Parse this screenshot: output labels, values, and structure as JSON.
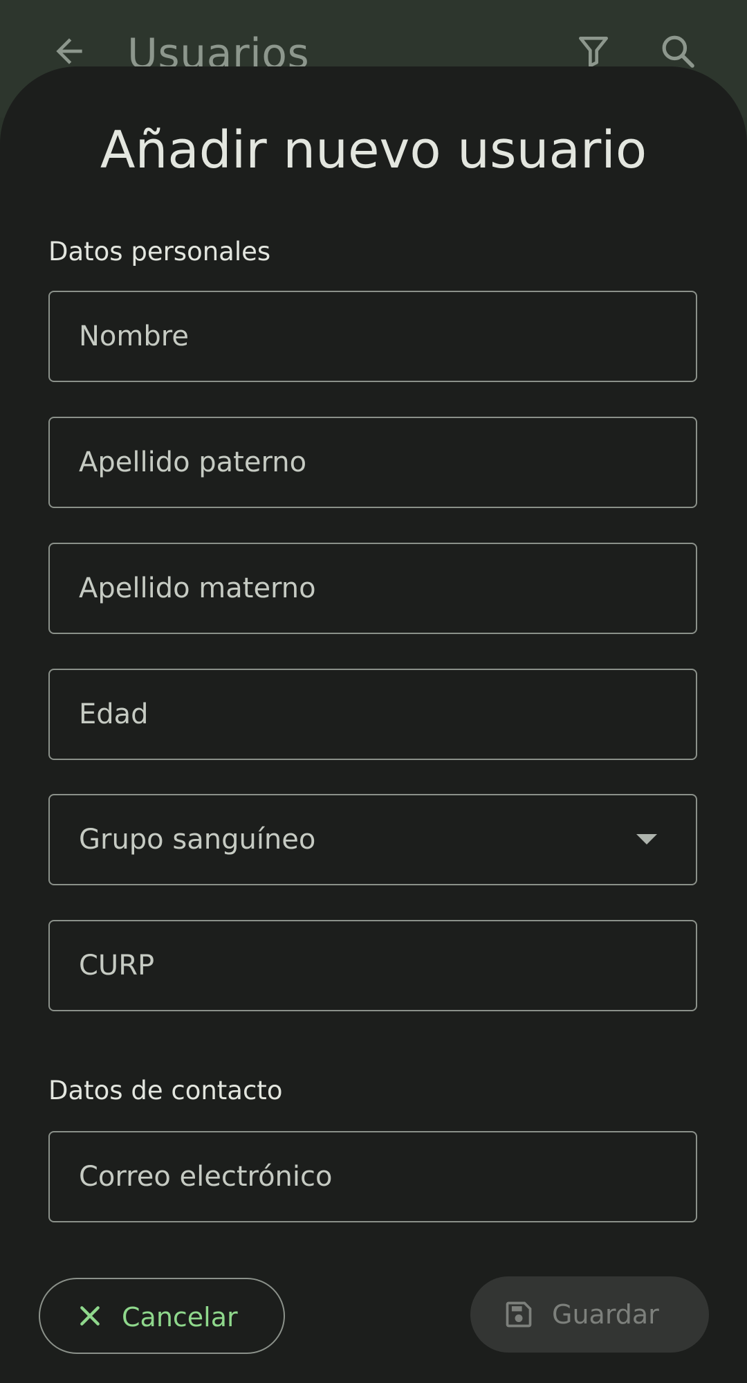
{
  "app_bar": {
    "title": "Usuarios",
    "back_icon": "arrow-back-icon",
    "filter_icon": "filter-icon",
    "search_icon": "search-icon"
  },
  "sheet": {
    "title": "Añadir nuevo usuario",
    "sections": {
      "personal": {
        "label": "Datos personales",
        "fields": {
          "nombre": {
            "placeholder": "Nombre",
            "value": ""
          },
          "apellido_paterno": {
            "placeholder": "Apellido paterno",
            "value": ""
          },
          "apellido_materno": {
            "placeholder": "Apellido materno",
            "value": ""
          },
          "edad": {
            "placeholder": "Edad",
            "value": ""
          },
          "grupo_sanguineo": {
            "placeholder": "Grupo sanguíneo",
            "value": ""
          },
          "curp": {
            "placeholder": "CURP",
            "value": ""
          }
        }
      },
      "contacto": {
        "label": "Datos de contacto",
        "fields": {
          "correo": {
            "placeholder": "Correo electrónico",
            "value": ""
          }
        }
      }
    }
  },
  "actions": {
    "cancel_label": "Cancelar",
    "save_label": "Guardar",
    "cancel_icon": "close-icon",
    "save_icon": "save-icon"
  },
  "colors": {
    "accent": "#8fd88c",
    "surface": "#1c1e1c",
    "app_bar": "#2d362d",
    "outline": "#8b918a"
  }
}
